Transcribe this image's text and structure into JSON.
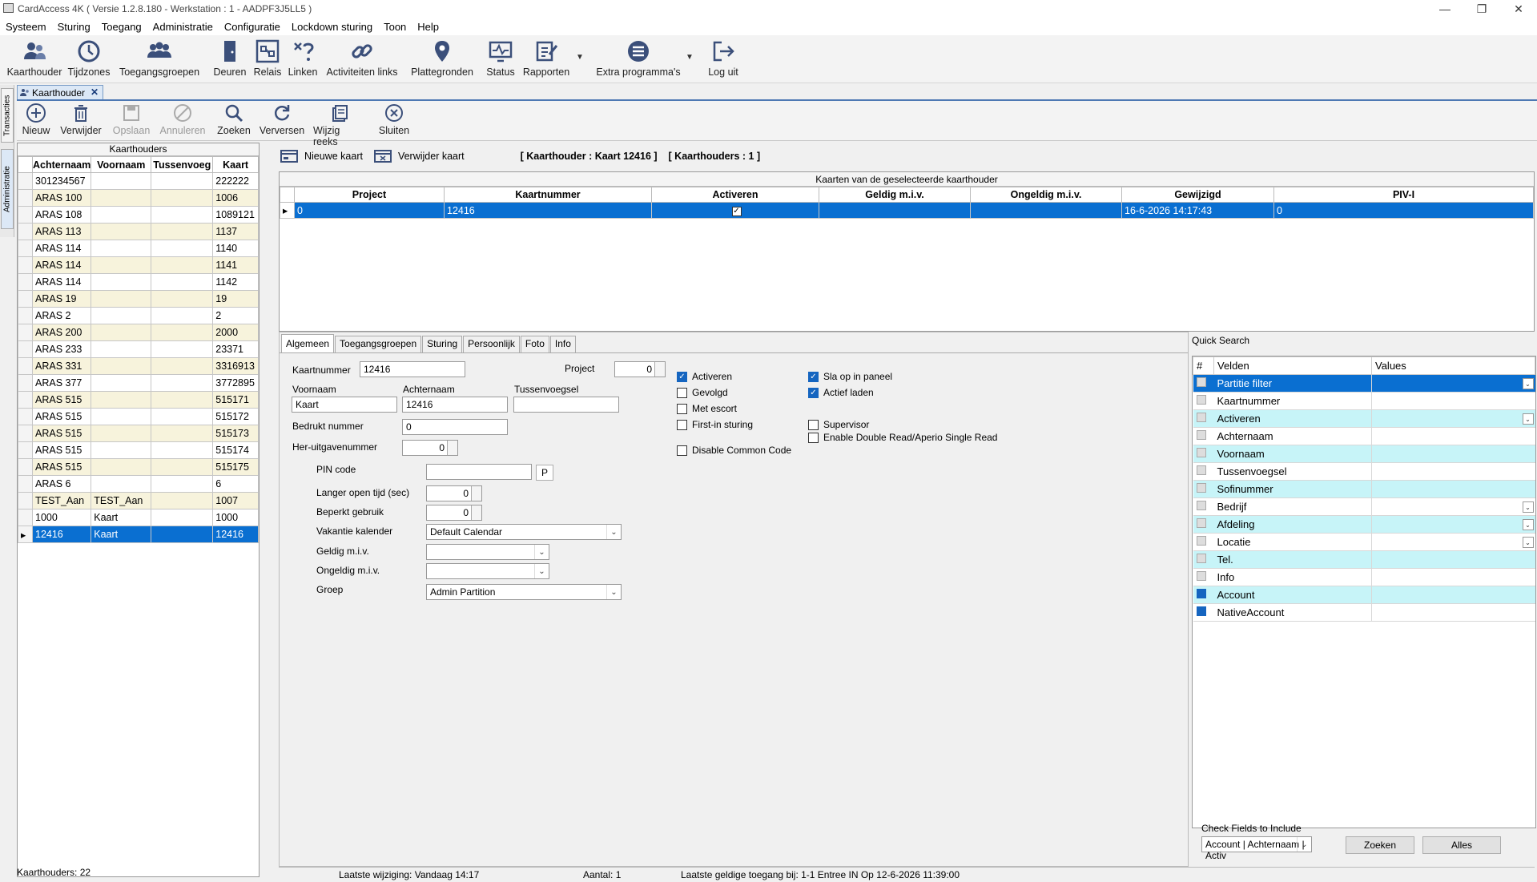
{
  "window": {
    "title": "CardAccess 4K ( Versie 1.2.8.180  -  Werkstation : 1 - AADPF3J5LL5 )"
  },
  "menu": [
    "Systeem",
    "Sturing",
    "Toegang",
    "Administratie",
    "Configuratie",
    "Lockdown sturing",
    "Toon",
    "Help"
  ],
  "toolbar": {
    "items": [
      "Kaarthouder",
      "Tijdzones",
      "Toegangsgroepen",
      "Deuren",
      "Relais",
      "Linken",
      "Activiteiten links",
      "Plattegronden",
      "Status",
      "Rapporten",
      "Extra programma's",
      "Log uit"
    ]
  },
  "side_tabs": [
    "Transacties",
    "Administratie"
  ],
  "doc_tab": "Kaarthouder",
  "subtoolbar": {
    "items": [
      "Nieuw",
      "Verwijder",
      "Opslaan",
      "Annuleren",
      "Zoeken",
      "Verversen",
      "Wijzig reeks",
      "Sluiten"
    ]
  },
  "cardholders": {
    "caption": "Kaarthouders",
    "columns": [
      "Achternaam",
      "Voornaam",
      "Tussenvoeg",
      "Kaart"
    ],
    "rows": [
      [
        "301234567",
        "",
        "",
        "222222"
      ],
      [
        "ARAS 100",
        "",
        "",
        "1006"
      ],
      [
        "ARAS 108",
        "",
        "",
        "1089121"
      ],
      [
        "ARAS 113",
        "",
        "",
        "1137"
      ],
      [
        "ARAS 114",
        "",
        "",
        "1140"
      ],
      [
        "ARAS 114",
        "",
        "",
        "1141"
      ],
      [
        "ARAS 114",
        "",
        "",
        "1142"
      ],
      [
        "ARAS 19",
        "",
        "",
        "19"
      ],
      [
        "ARAS 2",
        "",
        "",
        "2"
      ],
      [
        "ARAS 200",
        "",
        "",
        "2000"
      ],
      [
        "ARAS 233",
        "",
        "",
        "23371"
      ],
      [
        "ARAS 331",
        "",
        "",
        "3316913"
      ],
      [
        "ARAS 377",
        "",
        "",
        "3772895"
      ],
      [
        "ARAS 515",
        "",
        "",
        "515171"
      ],
      [
        "ARAS 515",
        "",
        "",
        "515172"
      ],
      [
        "ARAS 515",
        "",
        "",
        "515173"
      ],
      [
        "ARAS 515",
        "",
        "",
        "515174"
      ],
      [
        "ARAS 515",
        "",
        "",
        "515175"
      ],
      [
        "ARAS 6",
        "",
        "",
        "6"
      ],
      [
        "TEST_Aan",
        "TEST_Aan",
        "",
        "1007"
      ],
      [
        "1000",
        "Kaart",
        "",
        "1000"
      ],
      [
        "12416",
        "Kaart",
        "",
        "12416"
      ]
    ],
    "footer": "Kaarthouders: 22"
  },
  "cardbar": {
    "new": "Nieuwe kaart",
    "delete": "Verwijder kaart",
    "info1": "[  Kaarthouder  :  Kaart  12416  ]",
    "info2": "[  Kaarthouders   :  1  ]"
  },
  "cards": {
    "caption": "Kaarten van de geselecteerde kaarthouder",
    "columns": [
      "Project",
      "Kaartnummer",
      "Activeren",
      "Geldig m.i.v.",
      "Ongeldig m.i.v.",
      "Gewijzigd",
      "PIV-I"
    ],
    "row": {
      "project": "0",
      "kaartnummer": "12416",
      "activeren": true,
      "geldig": "",
      "ongeldig": "",
      "gewijzigd": "16-6-2026 14:17:43",
      "pivi": "0"
    }
  },
  "form": {
    "tabs": [
      "Algemeen",
      "Toegangsgroepen",
      "Sturing",
      "Persoonlijk",
      "Foto",
      "Info"
    ],
    "kaartnummer_label": "Kaartnummer",
    "kaartnummer": "12416",
    "project_label": "Project",
    "project": "0",
    "voornaam_label": "Voornaam",
    "voornaam": "Kaart",
    "achternaam_label": "Achternaam",
    "achternaam": "12416",
    "tussenvoegsel_label": "Tussenvoegsel",
    "tussenvoegsel": "",
    "bedrukt_label": "Bedrukt nummer",
    "bedrukt": "0",
    "heruitgave_label": "Her-uitgavenummer",
    "heruitgave": "0",
    "pin_label": "PIN code",
    "pin": "",
    "pin_btn": "P",
    "langer_label": "Langer open tijd (sec)",
    "langer": "0",
    "beperkt_label": "Beperkt gebruik",
    "beperkt": "0",
    "vakantie_label": "Vakantie kalender",
    "vakantie": "Default Calendar",
    "geldig_label": "Geldig m.i.v.",
    "geldig": "",
    "ongeldig_label": "Ongeldig m.i.v.",
    "ongeldig": "",
    "groep_label": "Groep",
    "groep": "Admin Partition",
    "checks": [
      {
        "label": "Activeren",
        "on": true
      },
      {
        "label": "Gevolgd",
        "on": false
      },
      {
        "label": "Met escort",
        "on": false
      },
      {
        "label": "First-in sturing",
        "on": false
      },
      {
        "label": "Disable Common Code",
        "on": false
      },
      {
        "label": "Sla op in paneel",
        "on": true
      },
      {
        "label": "Actief laden",
        "on": true
      },
      {
        "label": "Supervisor",
        "on": false
      },
      {
        "label": "Enable Double Read/Aperio Single Read",
        "on": false
      }
    ]
  },
  "quick_search": {
    "title": "Quick Search",
    "columns": [
      "#",
      "Velden",
      "Values"
    ],
    "rows": [
      {
        "veld": "Partitie filter",
        "on": false,
        "dd": true
      },
      {
        "veld": "Kaartnummer",
        "on": false,
        "dd": false
      },
      {
        "veld": "Activeren",
        "on": false,
        "dd": true
      },
      {
        "veld": "Achternaam",
        "on": false,
        "dd": false
      },
      {
        "veld": "Voornaam",
        "on": false,
        "dd": false
      },
      {
        "veld": "Tussenvoegsel",
        "on": false,
        "dd": false
      },
      {
        "veld": "Sofinummer",
        "on": false,
        "dd": false
      },
      {
        "veld": "Bedrijf",
        "on": false,
        "dd": true
      },
      {
        "veld": "Afdeling",
        "on": false,
        "dd": true
      },
      {
        "veld": "Locatie",
        "on": false,
        "dd": true
      },
      {
        "veld": "Tel.",
        "on": false,
        "dd": false
      },
      {
        "veld": "Info",
        "on": false,
        "dd": false
      },
      {
        "veld": "Account",
        "on": true,
        "dd": false
      },
      {
        "veld": "NativeAccount",
        "on": true,
        "dd": false
      }
    ],
    "check_label": "Check Fields to Include",
    "check_value": "Account | Achternaam | Activ",
    "search_btn": "Zoeken",
    "all_btn": "Alles"
  },
  "status": {
    "last_change": "Laatste wijziging: Vandaag 14:17",
    "count": "Aantal: 1",
    "last_access": "Laatste geldige toegang bij:  1-1 Entree IN  Op  12-6-2026 11:39:00"
  }
}
